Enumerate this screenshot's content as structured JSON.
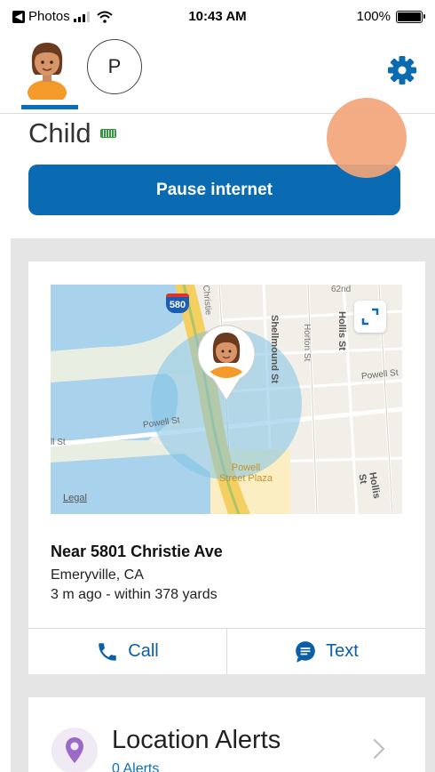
{
  "status_bar": {
    "back_app": "Photos",
    "time": "10:43 AM",
    "battery_percent": "100%",
    "battery_level": 1.0
  },
  "profiles": {
    "child_avatar_icon": "girl-avatar-icon",
    "second_profile_initial": "P",
    "settings_icon": "gear-icon"
  },
  "child": {
    "name": "Child",
    "device_battery_icon": "battery-full-icon"
  },
  "pause_button": {
    "label": "Pause internet"
  },
  "map": {
    "highway_shield": "580",
    "streets": [
      "Christie",
      "Shellmound St",
      "Horton St",
      "Hollis St",
      "62nd",
      "Powell St",
      "Powell St",
      "ll St",
      "Hollis St"
    ],
    "poi": "Powell\nStreet Plaza",
    "legal_label": "Legal",
    "expand_icon": "expand-icon"
  },
  "location": {
    "title": "Near 5801 Christie Ave",
    "city": "Emeryville, CA",
    "time_accuracy": "3 m ago - within 378 yards"
  },
  "actions": {
    "call_label": "Call",
    "call_icon": "phone-icon",
    "text_label": "Text",
    "text_icon": "chat-icon"
  },
  "alerts": {
    "title": "Location Alerts",
    "subtitle": "0 Alerts",
    "icon": "location-pin-icon"
  },
  "colors": {
    "accent": "#0a6bb3",
    "map_water": "#a9d2ec",
    "map_land": "#f1efe8",
    "radius_circle": "#7fc3e5",
    "touch_indicator": "#f2a57a"
  }
}
